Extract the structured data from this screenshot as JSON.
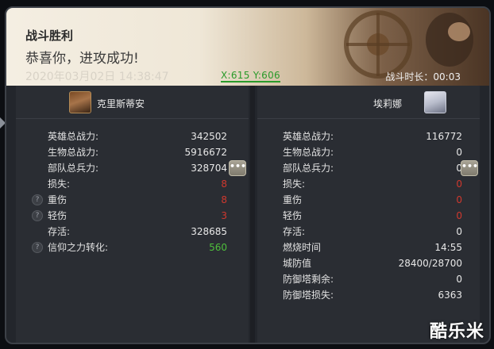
{
  "banner": {
    "title": "战斗胜利",
    "subtitle": "恭喜你，进攻成功!",
    "timestamp": "2020年03月02日 14:38:47",
    "coords": "X:615 Y:606",
    "duration_label": "战斗时长：",
    "duration_value": "00:03"
  },
  "left": {
    "name": "克里斯蒂安",
    "rows": [
      {
        "label": "英雄总战力:",
        "value": "342502"
      },
      {
        "label": "生物总战力:",
        "value": "5916672"
      },
      {
        "label": "部队总兵力:",
        "value": "328704"
      },
      {
        "label": "损失:",
        "value": "8"
      },
      {
        "label": "重伤",
        "value": "8"
      },
      {
        "label": "轻伤",
        "value": "3"
      },
      {
        "label": "存活:",
        "value": "328685"
      },
      {
        "label": "信仰之力转化:",
        "value": "560"
      }
    ]
  },
  "right": {
    "name": "埃莉娜",
    "rows": [
      {
        "label": "英雄总战力:",
        "value": "116772"
      },
      {
        "label": "生物总战力:",
        "value": "0"
      },
      {
        "label": "部队总兵力:",
        "value": "0"
      },
      {
        "label": "损失:",
        "value": "0"
      },
      {
        "label": "重伤",
        "value": "0"
      },
      {
        "label": "轻伤",
        "value": "0"
      },
      {
        "label": "存活:",
        "value": "0"
      },
      {
        "label": "燃烧时间",
        "value": "14:55"
      },
      {
        "label": "城防值",
        "value": "28400/28700"
      },
      {
        "label": "防御塔剩余:",
        "value": "0"
      },
      {
        "label": "防御塔损失:",
        "value": "6363"
      }
    ]
  },
  "more_label": "•••",
  "help_label": "?",
  "watermark": "酷乐米",
  "colors": {
    "loss": "#d0382e",
    "gain": "#4fbf3c",
    "coords": "#2a9a2a"
  }
}
